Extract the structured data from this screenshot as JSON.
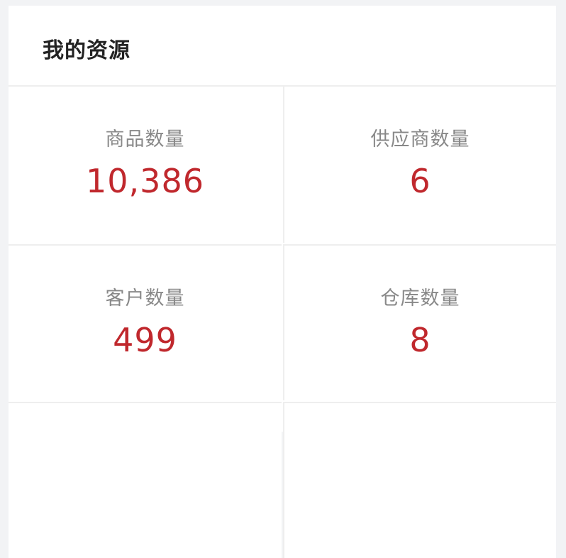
{
  "panel": {
    "title": "我的资源"
  },
  "stats": [
    {
      "label": "商品数量",
      "value": "10,386"
    },
    {
      "label": "供应商数量",
      "value": "6"
    },
    {
      "label": "客户数量",
      "value": "499"
    },
    {
      "label": "仓库数量",
      "value": "8"
    }
  ],
  "colors": {
    "value": "#c0282d",
    "label": "#888888",
    "background": "#f2f3f5"
  }
}
